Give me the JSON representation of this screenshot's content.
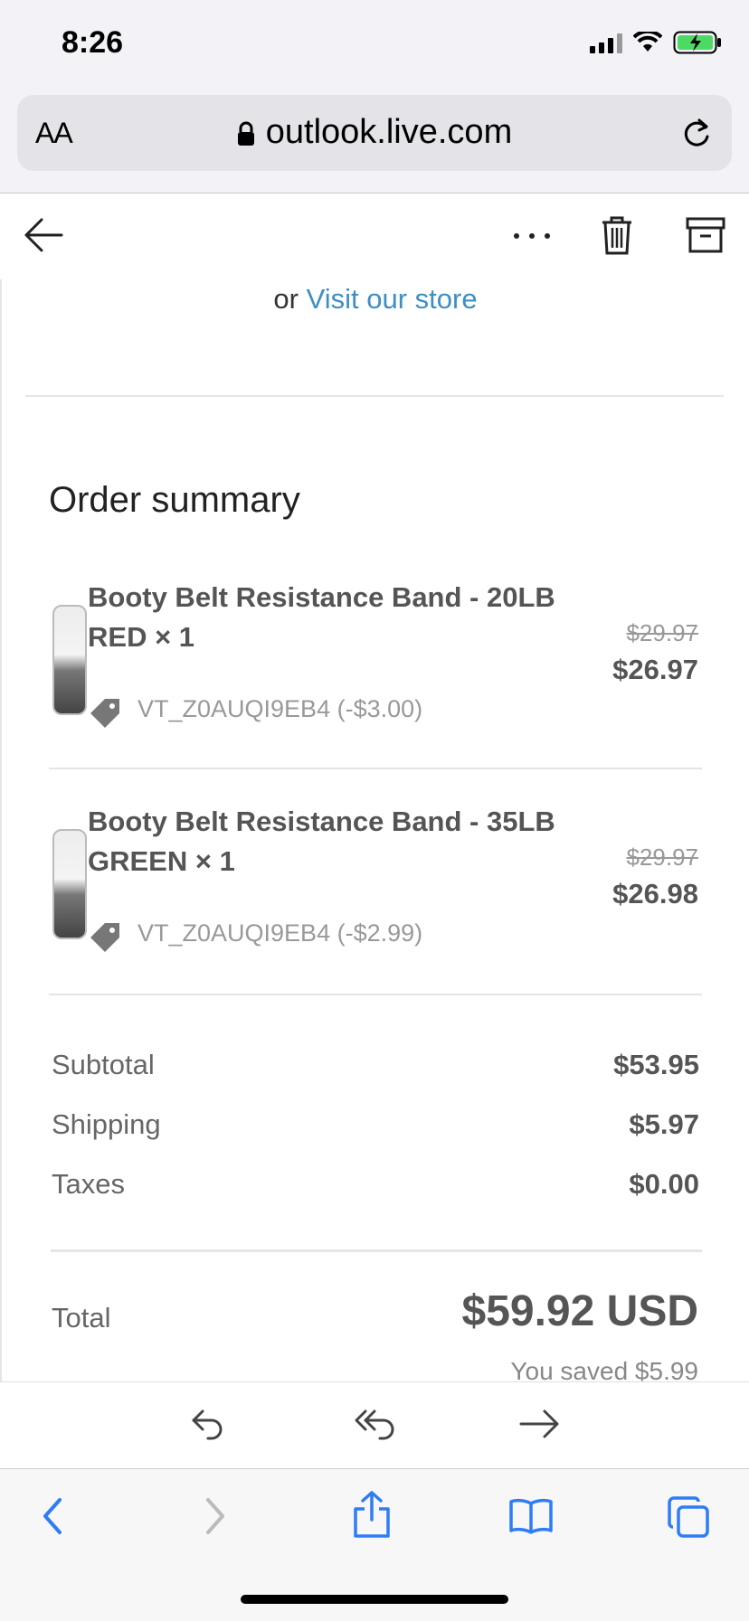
{
  "status_bar": {
    "time": "8:26"
  },
  "browser": {
    "text_size_label": "AA",
    "url": "outlook.live.com"
  },
  "email": {
    "visit_prefix": "or",
    "visit_link": "Visit our store",
    "order_summary_title": "Order summary",
    "items": [
      {
        "name": "Booty Belt Resistance Band - 20LB RED × 1",
        "original_price": "$29.97",
        "price": "$26.97",
        "discount": "VT_Z0AUQI9EB4 (-$3.00)"
      },
      {
        "name": "Booty Belt Resistance Band - 35LB GREEN × 1",
        "original_price": "$29.97",
        "price": "$26.98",
        "discount": "VT_Z0AUQI9EB4 (-$2.99)"
      }
    ],
    "summary": {
      "subtotal_label": "Subtotal",
      "subtotal": "$53.95",
      "shipping_label": "Shipping",
      "shipping": "$5.97",
      "taxes_label": "Taxes",
      "taxes": "$0.00",
      "total_label": "Total",
      "total": "$59.92 USD",
      "saved": "You saved $5.99"
    }
  },
  "icons": {
    "accent": "#3d8fc4",
    "safari_blue": "#2f7cf6",
    "battery": "#4cd964"
  }
}
